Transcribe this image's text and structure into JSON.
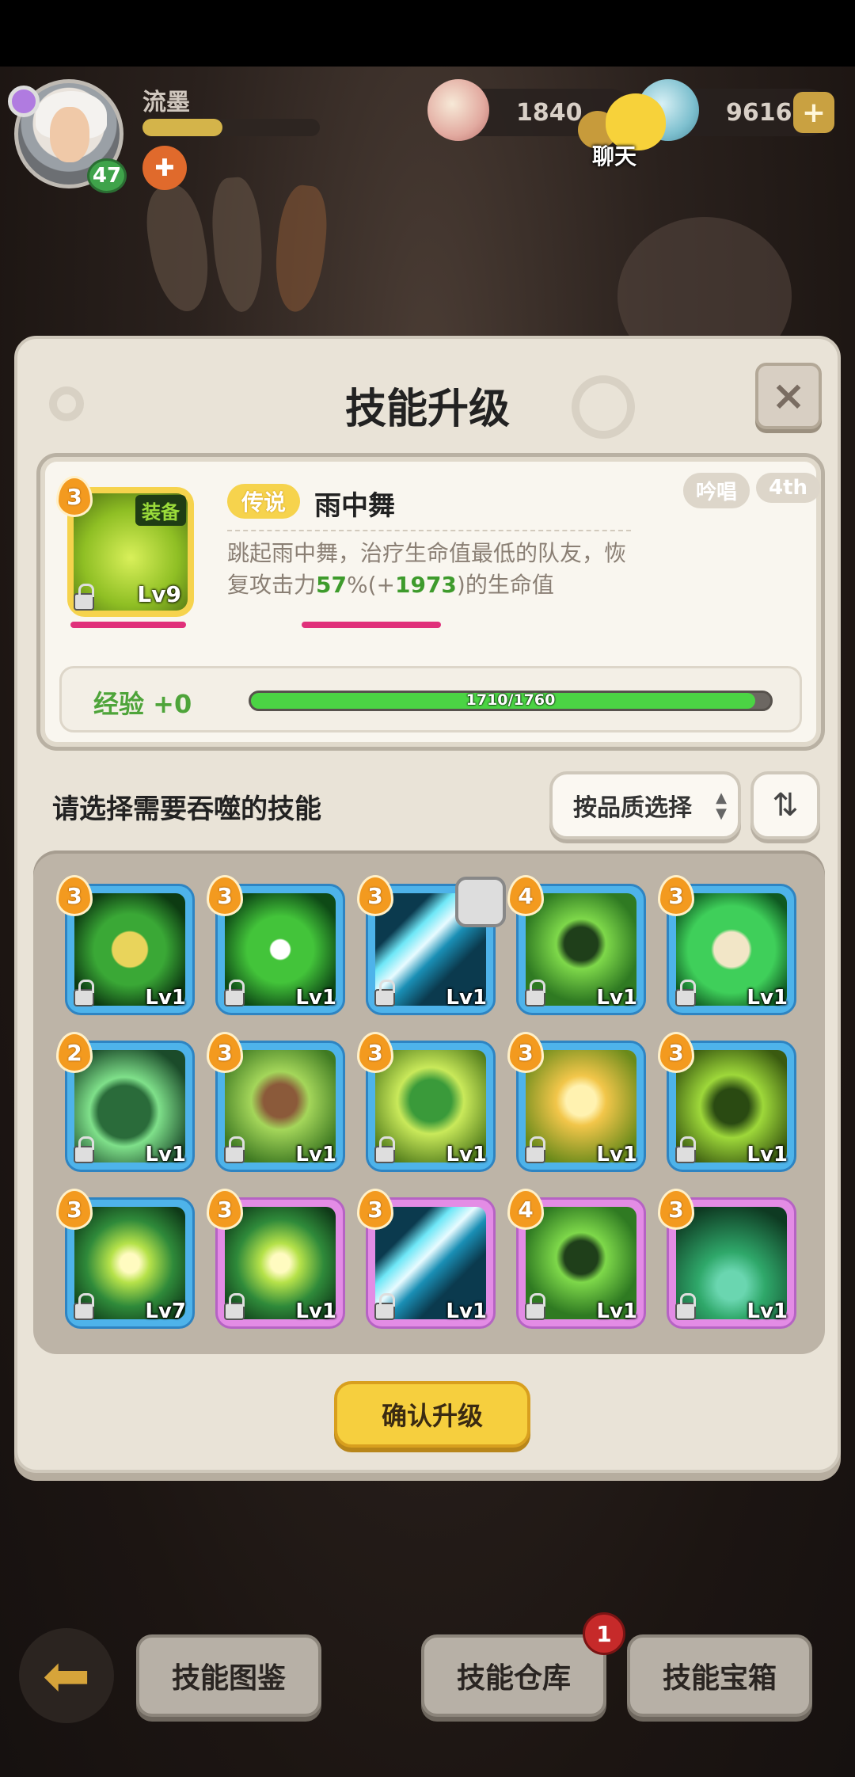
{
  "player": {
    "name": "流墨",
    "level": "47",
    "xp_fraction": 0.45
  },
  "currencies": {
    "shells": "1840",
    "gems": "96169",
    "plus_label": "+"
  },
  "chat": {
    "label": "聊天"
  },
  "dialog": {
    "title": "技能升级",
    "close_label": "×",
    "skill": {
      "star": "3",
      "equip_tag": "装备",
      "level": "Lv9",
      "rarity": "传说",
      "name": "雨中舞",
      "tag_type": "吟唱",
      "tag_order": "4th",
      "desc_part1": "跳起雨中舞，治疗生命值最低的队友，恢复攻击力",
      "desc_pct": "57",
      "desc_mid": "%(+",
      "desc_value": "1973",
      "desc_part2": ")的生命值"
    },
    "exp": {
      "label": "经验 +0",
      "text": "1710/1760",
      "current": 1710,
      "max": 1760
    },
    "select_prompt": "请选择需要吞噬的技能",
    "filter_label": "按品质选择",
    "sort_icon": "sort-icon",
    "confirm_label": "确认升级",
    "skills": [
      {
        "star": "3",
        "level": "Lv1",
        "frame": "blue",
        "art": "shield"
      },
      {
        "star": "3",
        "level": "Lv1",
        "frame": "blue",
        "art": "heart"
      },
      {
        "star": "3",
        "level": "Lv1",
        "frame": "blue",
        "art": "slash",
        "checkbox": true
      },
      {
        "star": "4",
        "level": "Lv1",
        "frame": "blue",
        "art": "totem"
      },
      {
        "star": "3",
        "level": "Lv1",
        "frame": "blue",
        "art": "rune"
      },
      {
        "star": "2",
        "level": "Lv1",
        "frame": "blue",
        "art": "ghost"
      },
      {
        "star": "3",
        "level": "Lv1",
        "frame": "blue",
        "art": "goblin"
      },
      {
        "star": "3",
        "level": "Lv1",
        "frame": "blue",
        "art": "drum"
      },
      {
        "star": "3",
        "level": "Lv1",
        "frame": "blue",
        "art": "gold"
      },
      {
        "star": "3",
        "level": "Lv1",
        "frame": "blue",
        "art": "frame"
      },
      {
        "star": "3",
        "level": "Lv7",
        "frame": "blue",
        "art": "drop"
      },
      {
        "star": "3",
        "level": "Lv1",
        "frame": "pink",
        "art": "drop"
      },
      {
        "star": "3",
        "level": "Lv1",
        "frame": "pink",
        "art": "slash"
      },
      {
        "star": "4",
        "level": "Lv1",
        "frame": "pink",
        "art": "totem"
      },
      {
        "star": "3",
        "level": "Lv1",
        "frame": "pink",
        "art": "bowl"
      }
    ]
  },
  "nav": {
    "back_icon": "back-arrow-icon",
    "encyclopedia": "技能图鉴",
    "warehouse": "技能仓库",
    "warehouse_badge": "1",
    "chest": "技能宝箱"
  },
  "colors": {
    "gold": "#f6d34d",
    "exp_green": "#4bd444",
    "frame_blue": "#4eb3ea",
    "frame_pink": "#e38ce5"
  }
}
